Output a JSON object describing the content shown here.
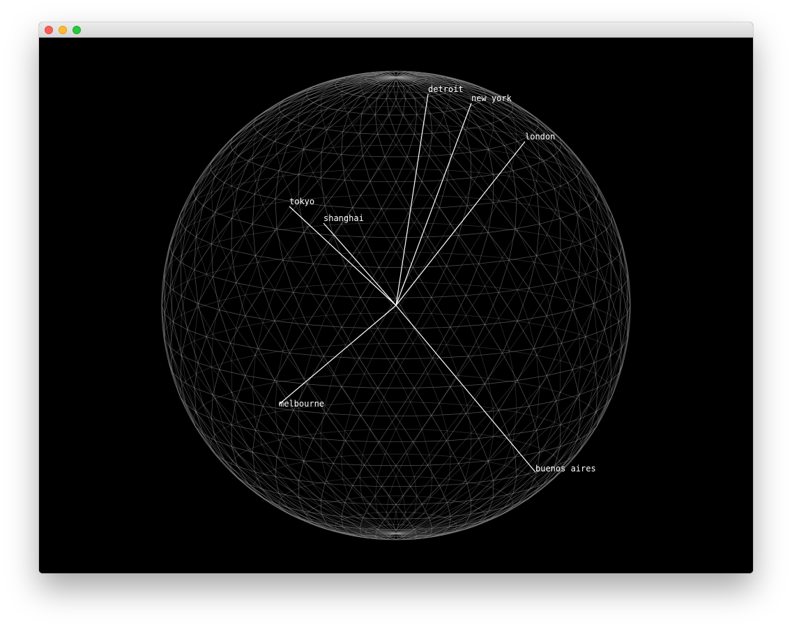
{
  "window": {
    "title": "",
    "controls": {
      "close": "close-button",
      "minimize": "minimize-button",
      "maximize": "maximize-button"
    }
  },
  "scene": {
    "background_color": "#000000",
    "globe_color": "#9a9a9a",
    "marker_color": "#ffffff"
  },
  "cities": [
    {
      "name": "detroit"
    },
    {
      "name": "new york"
    },
    {
      "name": "london"
    },
    {
      "name": "tokyo"
    },
    {
      "name": "shanghai"
    },
    {
      "name": "melbourne"
    },
    {
      "name": "buenos aires"
    }
  ]
}
